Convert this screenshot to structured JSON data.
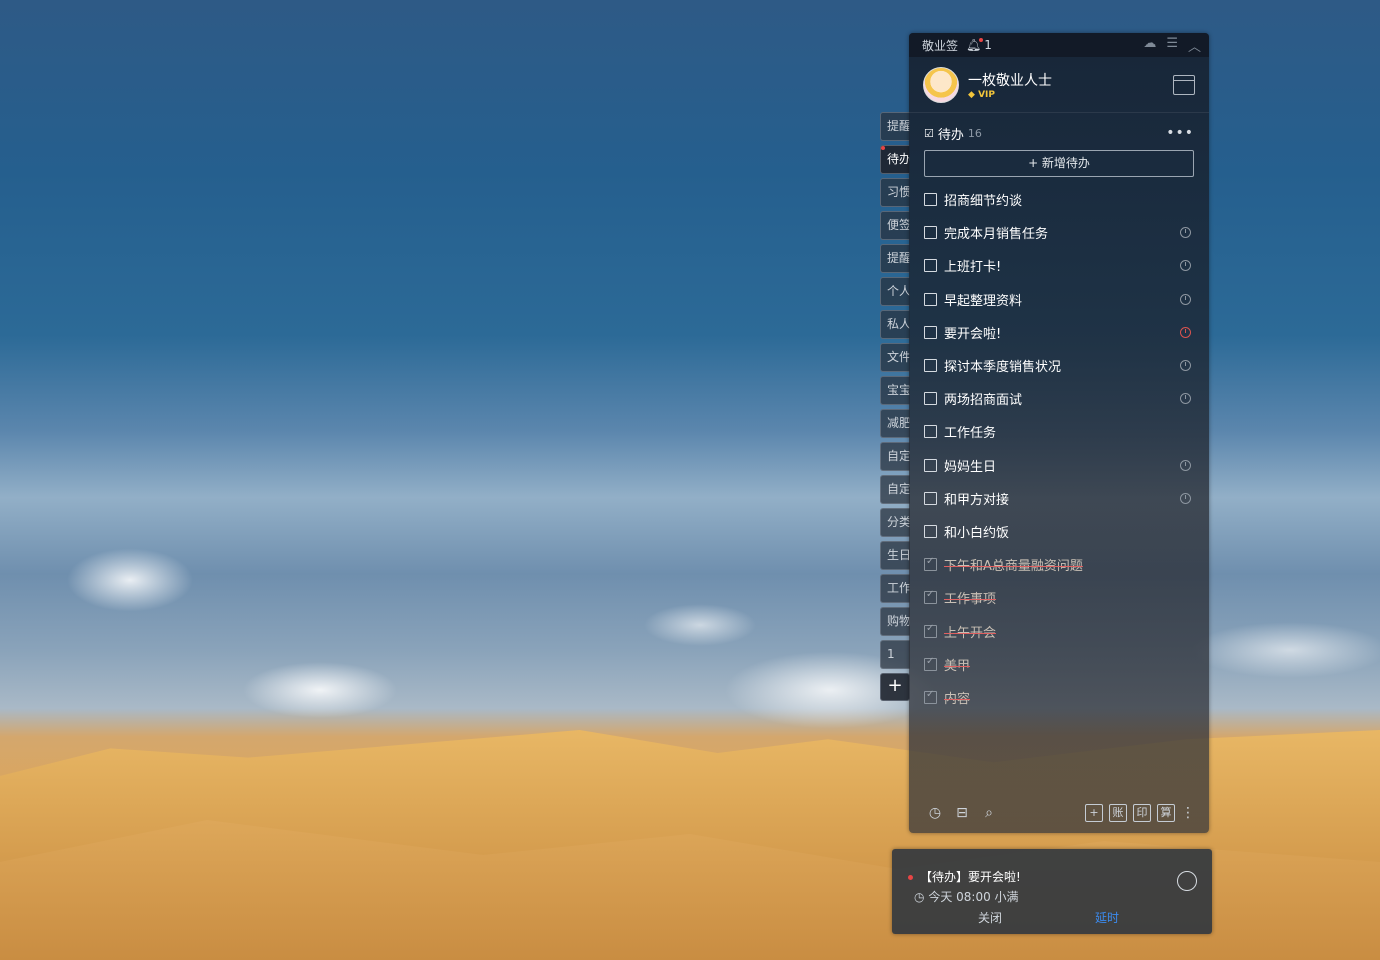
{
  "titlebar": {
    "app_name": "敬业签",
    "notif_count": "1"
  },
  "profile": {
    "username": "一枚敬业人士",
    "vip": "VIP"
  },
  "section": {
    "title": "待办",
    "count": "16",
    "more": "•••"
  },
  "add_todo_label": "+ 新增待办",
  "side_tabs": [
    "提醒",
    "待办",
    "习惯",
    "便签",
    "提醒",
    "个人",
    "私人",
    "文件",
    "宝宝",
    "减肥",
    "自定",
    "自定",
    "分类",
    "生日",
    "工作",
    "购物",
    "1"
  ],
  "side_add_label": "+",
  "todos": [
    {
      "text": "招商细节约谈",
      "done": false,
      "clock": "none"
    },
    {
      "text": "完成本月销售任务",
      "done": false,
      "clock": "gray"
    },
    {
      "text": "上班打卡!",
      "done": false,
      "clock": "gray"
    },
    {
      "text": "早起整理资料",
      "done": false,
      "clock": "gray"
    },
    {
      "text": "要开会啦!",
      "done": false,
      "clock": "red"
    },
    {
      "text": "探讨本季度销售状况",
      "done": false,
      "clock": "gray"
    },
    {
      "text": "两场招商面试",
      "done": false,
      "clock": "gray"
    },
    {
      "text": "工作任务",
      "done": false,
      "clock": "none"
    },
    {
      "text": "妈妈生日",
      "done": false,
      "clock": "gray"
    },
    {
      "text": "和甲方对接",
      "done": false,
      "clock": "gray"
    },
    {
      "text": "和小白约饭",
      "done": false,
      "clock": "none"
    },
    {
      "text": "下午和A总商量融资问题",
      "done": true,
      "clock": "none"
    },
    {
      "text": "工作事项",
      "done": true,
      "clock": "none"
    },
    {
      "text": "上午开会",
      "done": true,
      "clock": "none"
    },
    {
      "text": "美甲",
      "done": true,
      "clock": "none"
    },
    {
      "text": "内容",
      "done": true,
      "clock": "none"
    }
  ],
  "bottom_buttons": [
    "账",
    "印",
    "算"
  ],
  "notification": {
    "title": "【待办】要开会啦!",
    "time": "今天 08:00 小满",
    "close_label": "关闭",
    "delay_label": "延时"
  },
  "colors": {
    "accent_blue": "#3b8bf0",
    "alert_red": "#e84545"
  }
}
